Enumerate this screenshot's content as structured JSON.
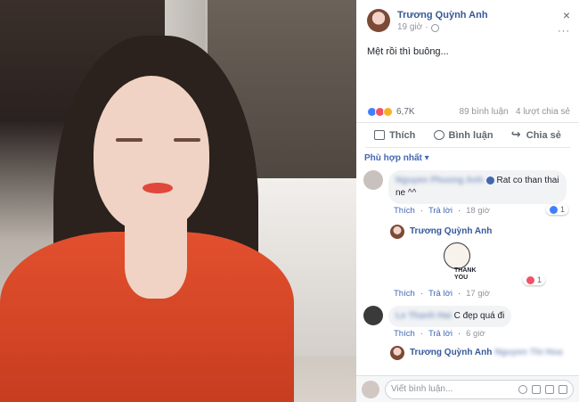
{
  "post": {
    "author": "Trương Quỳnh Anh",
    "time": "19 giờ",
    "text": "Mệt rồi thì buông...",
    "reactions_count": "6,7K",
    "comments_count": "89 bình luận",
    "shares_count": "4 lượt chia sẻ"
  },
  "actions": {
    "like": "Thích",
    "comment": "Bình luận",
    "share": "Chia sẻ"
  },
  "sort_label": "Phù hợp nhất ▾",
  "comments": [
    {
      "name": "Nguyen Phuong Anh",
      "text_line1": "Rat co than thai",
      "text_line2": "ne ^^",
      "like": "Thích",
      "reply": "Trả lời",
      "time": "18 giờ",
      "likes": "1"
    },
    {
      "name": "Trương Quỳnh Anh",
      "sticker_text_1": "THANK",
      "sticker_text_2": "YOU",
      "like": "Thích",
      "reply": "Trả lời",
      "time": "17 giờ",
      "loves": "1"
    },
    {
      "name": "Le Thanh Hai",
      "text": "C đẹp quá đi",
      "like": "Thích",
      "reply": "Trả lời",
      "time": "6 giờ"
    },
    {
      "name": "Trương Quỳnh Anh",
      "partial": "Nguyen Thi Hoa"
    }
  ],
  "write_placeholder": "Viết bình luận...",
  "close_icon": "×",
  "more_icon": "···"
}
